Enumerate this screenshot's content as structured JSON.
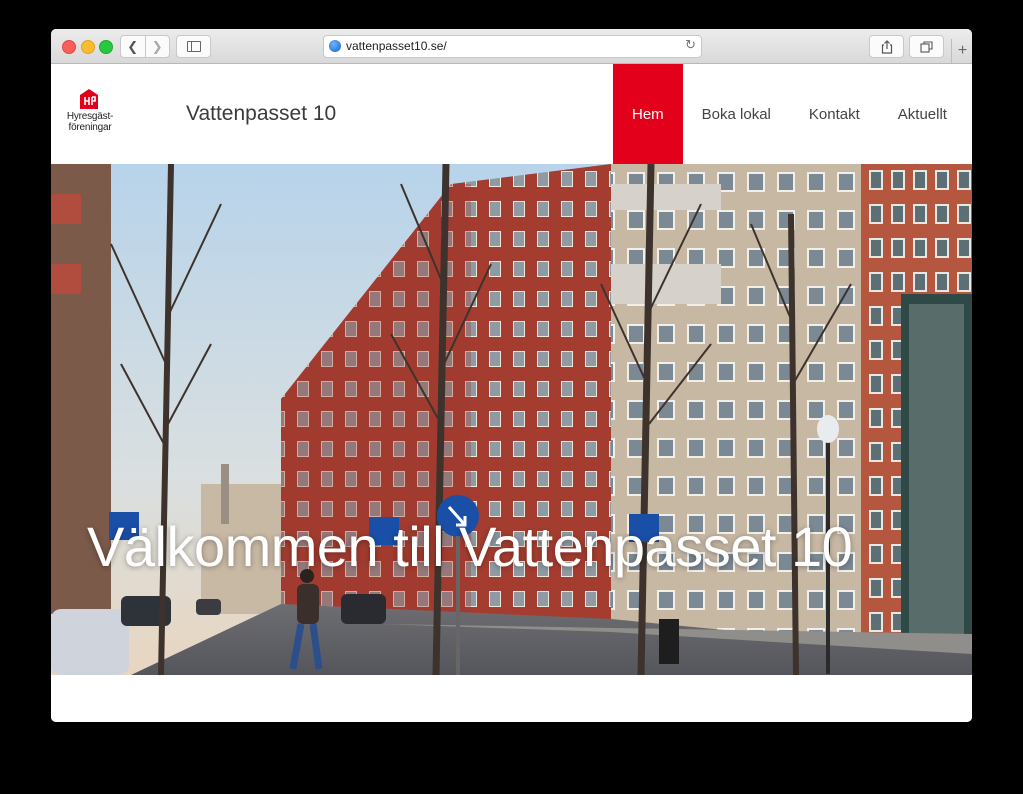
{
  "browser": {
    "url": "vattenpasset10.se/",
    "back_icon": "chevron-left-icon",
    "forward_icon": "chevron-right-icon",
    "reload_icon": "reload-icon",
    "share_icon": "share-icon",
    "tabs_icon": "tabs-overview-icon",
    "new_tab_label": "+"
  },
  "logo": {
    "line1": "Hyresgäst-",
    "line2": "föreningar"
  },
  "site": {
    "title": "Vattenpasset 10"
  },
  "nav": {
    "items": [
      {
        "label": "Hem",
        "active": true
      },
      {
        "label": "Boka lokal",
        "active": false
      },
      {
        "label": "Kontakt",
        "active": false
      },
      {
        "label": "Aktuellt",
        "active": false
      }
    ]
  },
  "hero": {
    "title": "Välkommen till Vattenpasset 10"
  },
  "colors": {
    "accent": "#e2001a",
    "text": "#444444"
  }
}
